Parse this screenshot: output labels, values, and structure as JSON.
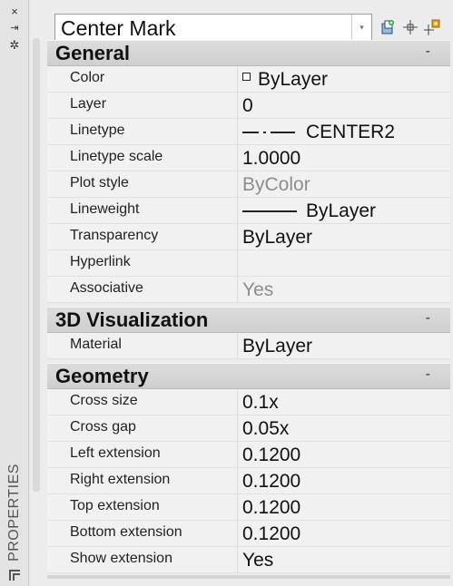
{
  "palette": {
    "title": "PROPERTIES",
    "close_glyph": "×",
    "pin_glyph": "⇥",
    "settings_glyph": "✲"
  },
  "selector": {
    "value": "Center Mark",
    "arrow_glyph": "▾"
  },
  "toolbar": {
    "icons": [
      "quick-select-icon",
      "select-objects-icon",
      "toggle-pickadd-icon"
    ]
  },
  "sections": {
    "general": {
      "title": "General",
      "collapse": "-",
      "rows": [
        {
          "label": "Color",
          "value": "ByLayer"
        },
        {
          "label": "Layer",
          "value": "0"
        },
        {
          "label": "Linetype",
          "value": "CENTER2"
        },
        {
          "label": "Linetype scale",
          "value": "1.0000"
        },
        {
          "label": "Plot style",
          "value": "ByColor"
        },
        {
          "label": "Lineweight",
          "value": "ByLayer"
        },
        {
          "label": "Transparency",
          "value": "ByLayer"
        },
        {
          "label": "Hyperlink",
          "value": ""
        },
        {
          "label": "Associative",
          "value": "Yes"
        }
      ]
    },
    "visualization": {
      "title": "3D Visualization",
      "collapse": "-",
      "rows": [
        {
          "label": "Material",
          "value": "ByLayer"
        }
      ]
    },
    "geometry": {
      "title": "Geometry",
      "collapse": "-",
      "rows": [
        {
          "label": "Cross size",
          "value": "0.1x"
        },
        {
          "label": "Cross gap",
          "value": "0.05x"
        },
        {
          "label": "Left extension",
          "value": "0.1200"
        },
        {
          "label": "Right extension",
          "value": "0.1200"
        },
        {
          "label": "Top extension",
          "value": "0.1200"
        },
        {
          "label": "Bottom extension",
          "value": "0.1200"
        },
        {
          "label": "Show extension",
          "value": "Yes"
        }
      ]
    }
  },
  "colors": {
    "muted_value": "#8d8d8d",
    "section_header": "#d4d4d4",
    "row_background": "#f1f1f1"
  }
}
